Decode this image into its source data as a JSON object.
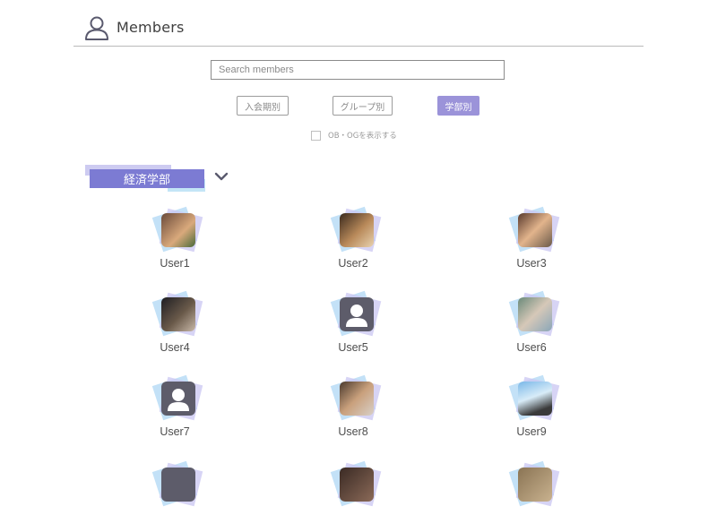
{
  "header": {
    "title": "Members",
    "icon": "person-outline-icon"
  },
  "search": {
    "placeholder": "Search members",
    "value": ""
  },
  "filters": [
    {
      "label": "入会期別",
      "active": false
    },
    {
      "label": "グループ別",
      "active": false
    },
    {
      "label": "学部別",
      "active": true
    }
  ],
  "show_alumni": {
    "label": "OB・OGを表示する",
    "checked": false
  },
  "faculty": {
    "label": "経済学部",
    "expand_icon": "chevron-down-icon"
  },
  "colors": {
    "accent": "#7c7bd3",
    "accent_light": "#9b93d9",
    "deco_blue": "#b8dcf6",
    "deco_lilac": "#c9c6f1"
  },
  "members": [
    {
      "name": "User1",
      "avatar": "photo"
    },
    {
      "name": "User2",
      "avatar": "photo"
    },
    {
      "name": "User3",
      "avatar": "photo"
    },
    {
      "name": "User4",
      "avatar": "photo"
    },
    {
      "name": "User5",
      "avatar": "default-person-icon"
    },
    {
      "name": "User6",
      "avatar": "photo"
    },
    {
      "name": "User7",
      "avatar": "default-person-icon"
    },
    {
      "name": "User8",
      "avatar": "photo"
    },
    {
      "name": "User9",
      "avatar": "photo"
    }
  ]
}
